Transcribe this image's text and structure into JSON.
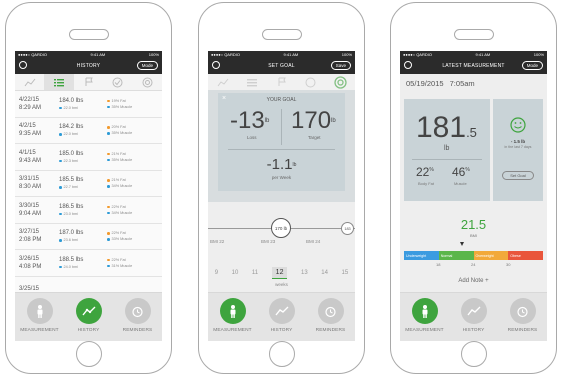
{
  "colors": {
    "accent_green": "#3ea43e",
    "bar_dark": "#2b2b2b",
    "fat_dot": "#f29a2e",
    "muscle_dot": "#2e9bd6",
    "underweight": "#3b9be0",
    "normal": "#5bb64a",
    "overweight": "#f2a93a",
    "obese": "#e9553b"
  },
  "status": {
    "carrier": "●●●●○ QARDIO",
    "time": "9:41 AM",
    "battery": "100%"
  },
  "nav": [
    {
      "label": "MEASUREMENT",
      "icon": "person-icon"
    },
    {
      "label": "HISTORY",
      "icon": "trend-icon"
    },
    {
      "label": "REMINDERS",
      "icon": "alarm-clock-icon"
    }
  ],
  "history": {
    "title": "HISTORY",
    "mode_label": "Mode",
    "tabs": [
      "trend-icon",
      "list-icon",
      "flag-icon",
      "check-icon",
      "target-icon"
    ],
    "rows": [
      {
        "date": "4/22/15",
        "time": "8:29 AM",
        "weight": "184.0 lbs",
        "bmi": "22.0 bmi",
        "fat": "19% Fat",
        "muscle": "35% Muscle"
      },
      {
        "date": "4/2/15",
        "time": "9:35 AM",
        "weight": "184.2 lbs",
        "bmi": "22.0 bmi",
        "fat": "20% Fat",
        "muscle": "35% Muscle"
      },
      {
        "date": "4/1/15",
        "time": "9:43 AM",
        "weight": "185.0 lbs",
        "bmi": "22.3 bmi",
        "fat": "21% Fat",
        "muscle": "35% Muscle"
      },
      {
        "date": "3/31/15",
        "time": "8:30 AM",
        "weight": "185.5 lbs",
        "bmi": "22.7 bmi",
        "fat": "21% Fat",
        "muscle": "34% Muscle"
      },
      {
        "date": "3/30/15",
        "time": "9:04 AM",
        "weight": "186.5 lbs",
        "bmi": "23.0 bmi",
        "fat": "22% Fat",
        "muscle": "34% Muscle"
      },
      {
        "date": "3/27/15",
        "time": "2:08 PM",
        "weight": "187.0 lbs",
        "bmi": "23.6 bmi",
        "fat": "22% Fat",
        "muscle": "33% Muscle"
      },
      {
        "date": "3/26/15",
        "time": "4:08 PM",
        "weight": "188.5 lbs",
        "bmi": "24.0 bmi",
        "fat": "22% Fat",
        "muscle": "31% Muscle"
      },
      {
        "date": "3/25/15",
        "time": "",
        "weight": "",
        "bmi": "",
        "fat": "",
        "muscle": ""
      }
    ]
  },
  "goal": {
    "title": "SET GOAL",
    "save_label": "Save",
    "card_title": "YOUR GOAL",
    "loss_value": "-13",
    "loss_unit": "lb",
    "loss_label": "Loss",
    "target_value": "170",
    "target_unit": "lb",
    "target_label": "Target",
    "rate_value": "-1.1",
    "rate_unit": "lb",
    "rate_label": "per Week",
    "slider_value": "170 lb",
    "slider_end": "183",
    "bmi_ticks": [
      "BMI 22",
      "BMI 23",
      "BMI 24"
    ],
    "weeks": [
      "9",
      "10",
      "11",
      "12",
      "13",
      "14",
      "15"
    ],
    "selected_week": "12",
    "weeks_label": "weeks"
  },
  "latest": {
    "title": "LATEST MEASUREMENT",
    "mode_label": "Mode",
    "date": "05/19/2015",
    "time": "7:05am",
    "weight_int": "181",
    "weight_dec": ".5",
    "weight_unit": "lb",
    "change_value": "- 1.5 lb",
    "change_label": "in the last 7 days",
    "set_goal_label": "Set Goal",
    "fat_value": "22",
    "fat_unit": "%",
    "fat_label": "Body Fat",
    "muscle_value": "46",
    "muscle_unit": "%",
    "muscle_label": "Muscle",
    "bmi_value": "21.5",
    "bmi_label": "BMI",
    "scale_labels": [
      "Underweight",
      "Normal",
      "Overweight",
      "Obese"
    ],
    "scale_ticks": [
      "18",
      "24",
      "30"
    ],
    "bmi_marker_fraction": 0.42,
    "add_note_label": "Add Note +"
  }
}
